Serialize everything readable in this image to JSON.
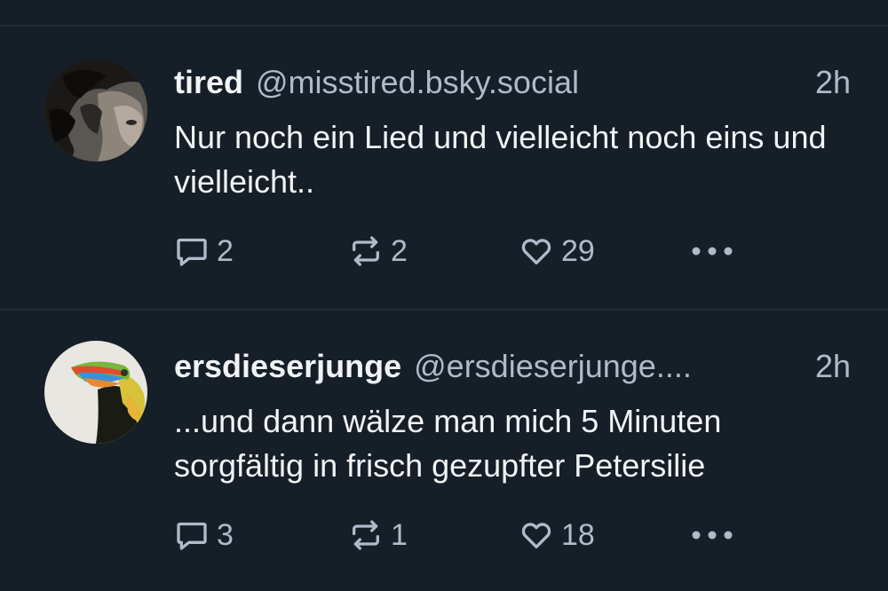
{
  "posts": [
    {
      "author_name": "tired",
      "handle": "@misstired.bsky.social",
      "time": "2h",
      "text": "Nur noch ein Lied und vielleicht noch eins und vielleicht..",
      "replies": "2",
      "reposts": "2",
      "likes": "29",
      "avatar": "woman-dark-hair-photo"
    },
    {
      "author_name": "ersdieserjunge",
      "handle": "@ersdieserjunge....",
      "time": "2h",
      "text": "...und dann wälze man mich 5 Minuten sorgfältig in frisch gezupfter Petersilie",
      "replies": "3",
      "reposts": "1",
      "likes": "18",
      "avatar": "toucan-photo"
    }
  ],
  "icons": {
    "reply": "reply-icon",
    "repost": "repost-icon",
    "like": "heart-icon",
    "more": "more-dots-icon"
  },
  "colors": {
    "background": "#161e27",
    "divider": "#232d38",
    "primary_text": "#f1f3f5",
    "secondary_text": "#aebbc9"
  }
}
